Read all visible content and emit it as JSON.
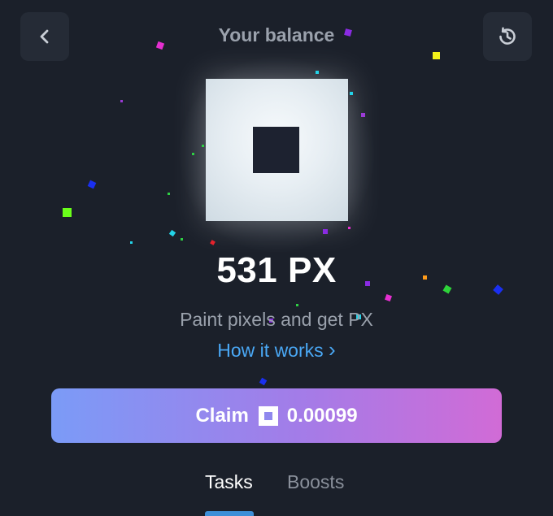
{
  "header": {
    "title": "Your balance",
    "back_icon": "chevron-left-icon",
    "history_icon": "history-icon"
  },
  "balance": {
    "amount": "531 PX",
    "subtitle": "Paint pixels and get PX",
    "link_label": "How it works",
    "link_chevron": "›"
  },
  "claim": {
    "label": "Claim",
    "amount": "0.00099",
    "token_icon": "px-token-icon"
  },
  "tabs": [
    {
      "label": "Tasks",
      "active": true
    },
    {
      "label": "Boosts",
      "active": false
    }
  ],
  "colors": {
    "background": "#1b202a",
    "link": "#4aa8f5",
    "muted_text": "#9aa1ac",
    "tab_indicator": "#3d8fd8",
    "claim_gradient_start": "#7b9bf7",
    "claim_gradient_end": "#d16bd6"
  }
}
